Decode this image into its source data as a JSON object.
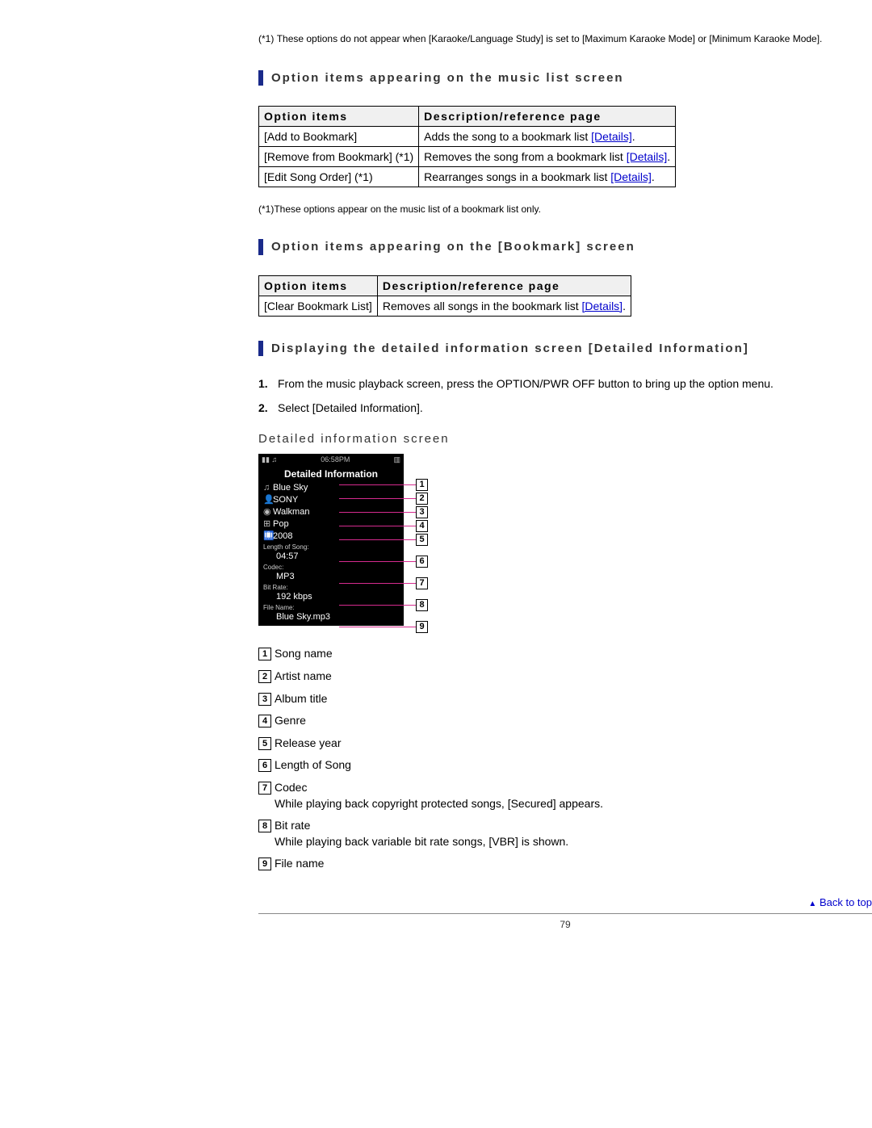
{
  "top_footnote": {
    "label": "(*1)",
    "text": "These options do not appear when [Karaoke/Language Study] is set to [Maximum Karaoke Mode] or [Minimum Karaoke Mode]."
  },
  "section1": {
    "heading": "Option items appearing on the music list screen",
    "table": {
      "headers": [
        "Option items",
        "Description/reference page"
      ],
      "rows": [
        {
          "option": "[Add to Bookmark]",
          "desc": "Adds the song to a bookmark list ",
          "link": "[Details]",
          "tail": "."
        },
        {
          "option": "[Remove from Bookmark] (*1)",
          "desc": "Removes the song from a bookmark list ",
          "link": "[Details]",
          "tail": "."
        },
        {
          "option": "[Edit Song Order] (*1)",
          "desc": "Rearranges songs in a bookmark list ",
          "link": "[Details]",
          "tail": "."
        }
      ]
    },
    "footnote": "(*1)These options appear on the music list of a bookmark list only."
  },
  "section2": {
    "heading": "Option items appearing on the [Bookmark] screen",
    "table": {
      "headers": [
        "Option items",
        "Description/reference page"
      ],
      "rows": [
        {
          "option": "[Clear Bookmark List]",
          "desc": "Removes all songs in the bookmark list ",
          "link": "[Details]",
          "tail": "."
        }
      ]
    }
  },
  "section3": {
    "heading": "Displaying the detailed information screen [Detailed Information]",
    "steps": [
      "From the music playback screen, press the OPTION/PWR OFF button to bring up the option menu.",
      "Select [Detailed Information]."
    ],
    "sub_heading": "Detailed information screen",
    "screen": {
      "time": "06:58PM",
      "title": "Detailed Information",
      "rows": [
        {
          "icon": "♫",
          "text": "Blue Sky",
          "callout": "1"
        },
        {
          "icon": "👤",
          "text": "SONY",
          "callout": "2"
        },
        {
          "icon": "◉",
          "text": "Walkman",
          "callout": "3"
        },
        {
          "icon": "⊞",
          "text": "Pop",
          "callout": "4"
        },
        {
          "icon": "🛄",
          "text": "2008",
          "callout": "5"
        },
        {
          "label": "Length of Song:",
          "text": "04:57",
          "callout": "6"
        },
        {
          "label": "Codec:",
          "text": "MP3",
          "callout": "7"
        },
        {
          "label": "Bit Rate:",
          "text": "192 kbps",
          "callout": "8"
        },
        {
          "label": "File Name:",
          "text": "Blue Sky.mp3",
          "callout": "9"
        }
      ]
    },
    "legend": [
      {
        "num": "1",
        "text": "Song name"
      },
      {
        "num": "2",
        "text": "Artist name"
      },
      {
        "num": "3",
        "text": "Album title"
      },
      {
        "num": "4",
        "text": "Genre"
      },
      {
        "num": "5",
        "text": "Release year"
      },
      {
        "num": "6",
        "text": "Length of Song"
      },
      {
        "num": "7",
        "text": "Codec\nWhile playing back copyright protected songs, [Secured] appears."
      },
      {
        "num": "8",
        "text": "Bit rate\nWhile playing back variable bit rate songs, [VBR] is shown."
      },
      {
        "num": "9",
        "text": "File name"
      }
    ]
  },
  "back_to_top": "Back to top",
  "page_number": "79"
}
